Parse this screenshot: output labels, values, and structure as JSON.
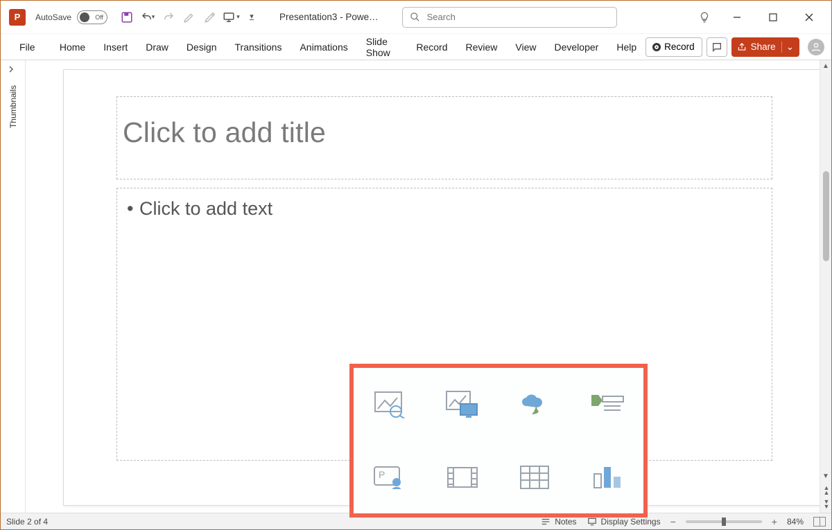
{
  "titlebar": {
    "autosave_label": "AutoSave",
    "autosave_state": "Off",
    "document_title": "Presentation3 - Powe…",
    "search_placeholder": "Search"
  },
  "qat_icons": [
    "save-icon",
    "undo-icon",
    "redo-icon",
    "edit-icon",
    "touch-icon",
    "present-icon",
    "more-icon"
  ],
  "window_controls": [
    "lightbulb-icon",
    "minimize-icon",
    "restore-icon",
    "close-icon"
  ],
  "ribbon": {
    "tabs": [
      "File",
      "Home",
      "Insert",
      "Draw",
      "Design",
      "Transitions",
      "Animations",
      "Slide Show",
      "Record",
      "Review",
      "View",
      "Developer",
      "Help"
    ],
    "record_label": "Record",
    "share_label": "Share"
  },
  "rail": {
    "label": "Thumbnails"
  },
  "slide": {
    "title_placeholder": "Click to add title",
    "body_placeholder": "Click to add text",
    "content_icons": [
      "stock-images-icon",
      "online-pictures-icon",
      "icons-icon",
      "smartart-icon",
      "cameo-icon",
      "video-icon",
      "table-icon",
      "chart-icon"
    ]
  },
  "statusbar": {
    "slide_indicator": "Slide 2 of 4",
    "notes_label": "Notes",
    "display_label": "Display Settings",
    "zoom_pct": "84%"
  },
  "colors": {
    "accent": "#c43e1c",
    "highlight_box": "#f2614b"
  }
}
